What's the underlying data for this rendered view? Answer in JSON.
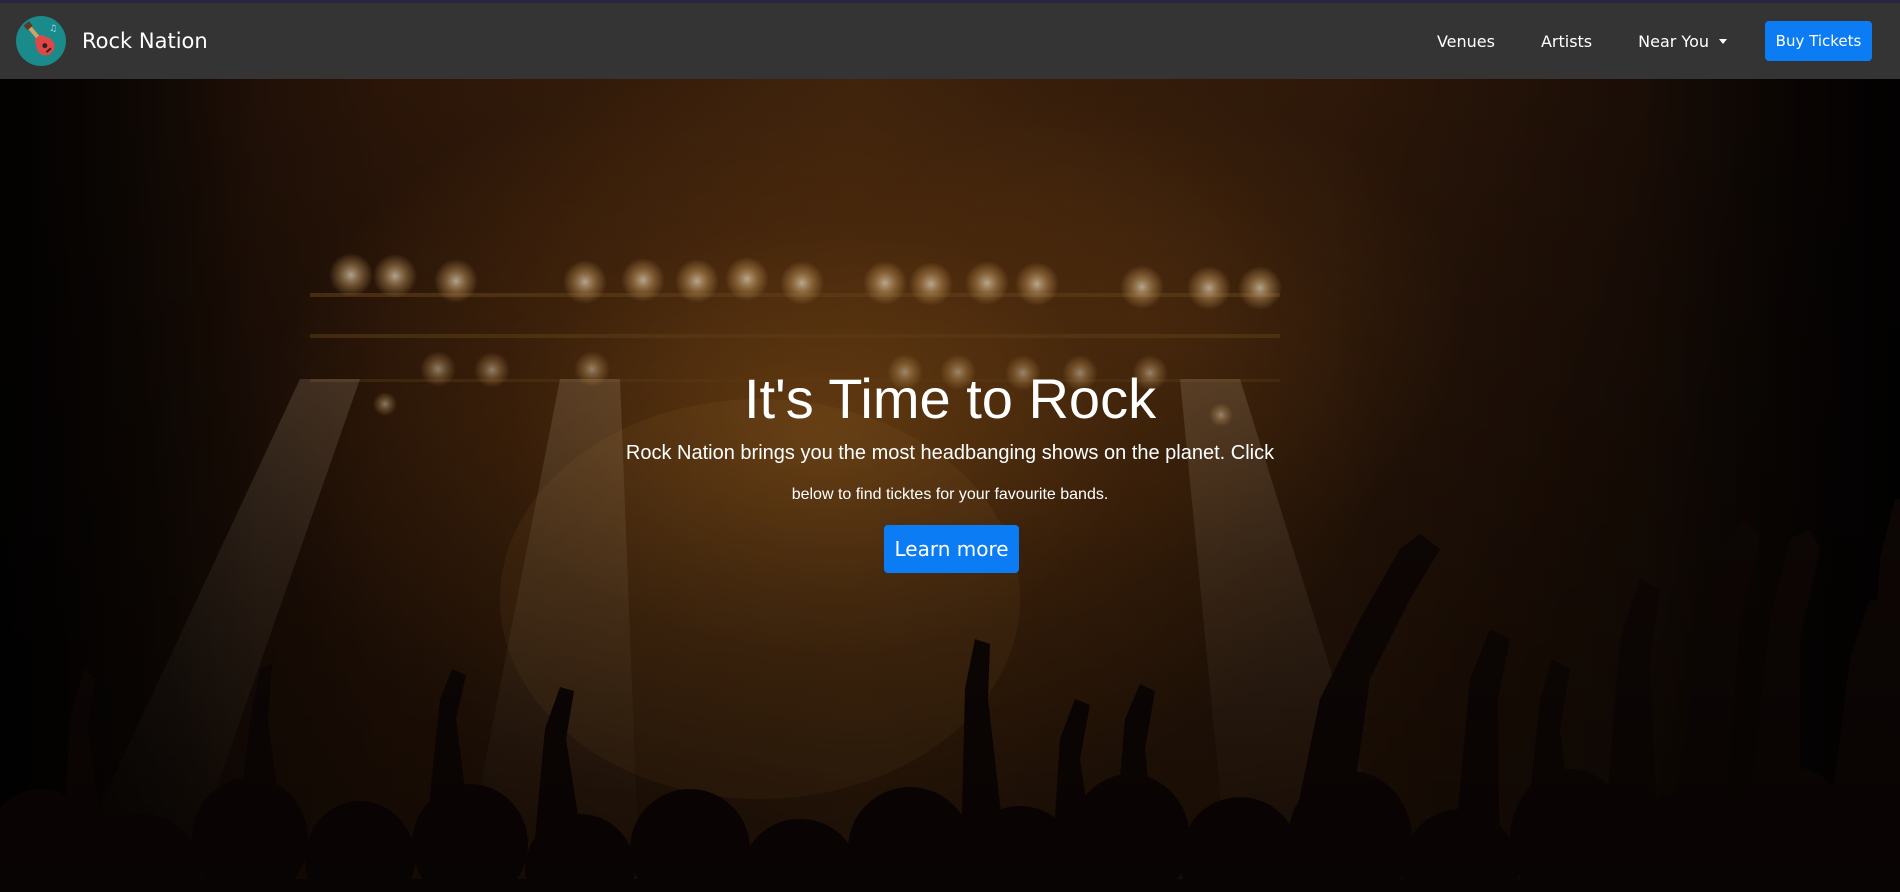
{
  "navbar": {
    "brand": "Rock Nation",
    "logo_icon": "guitar-icon",
    "links": [
      {
        "label": "Venues"
      },
      {
        "label": "Artists"
      },
      {
        "label": "Near You"
      }
    ],
    "buy_button": "Buy Tickets"
  },
  "hero": {
    "title": "It's Time to Rock",
    "subtitle_line1": "Rock Nation brings you the most headbanging shows on the planet. Click",
    "subtitle_line2": "below to find ticktes for your favourite bands.",
    "cta": "Learn more",
    "background": "concert-crowd-image"
  },
  "colors": {
    "navbar": "#343434",
    "primary": "#0b7cf4",
    "logo": "#1a8a8a"
  }
}
